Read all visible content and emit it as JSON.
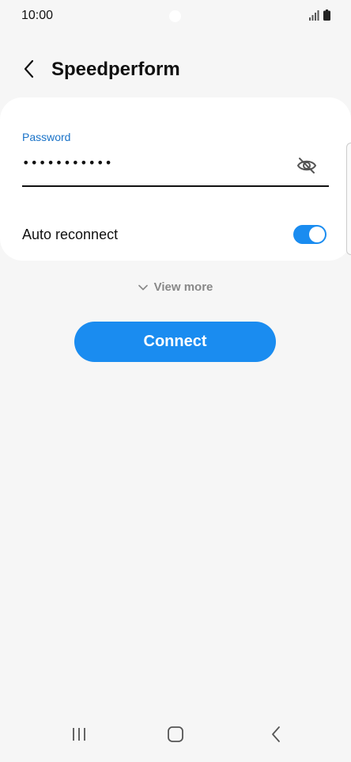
{
  "status_bar": {
    "time": "10:00",
    "icons": [
      "signal-icon",
      "battery-icon"
    ]
  },
  "header": {
    "title": "Speedperform",
    "back_icon": "chevron-left-icon"
  },
  "form": {
    "password_label": "Password",
    "password_value": "•••••••••••",
    "visibility_icon": "eye-off-icon",
    "auto_reconnect_label": "Auto reconnect",
    "auto_reconnect_enabled": true
  },
  "view_more": {
    "label": "View more",
    "icon": "chevron-down-icon"
  },
  "connect": {
    "label": "Connect"
  },
  "nav_bar": {
    "icons": [
      "recents-icon",
      "home-icon",
      "back-icon"
    ]
  },
  "colors": {
    "accent": "#1a8cf0",
    "label_blue": "#1a73c8",
    "background": "#f6f6f6",
    "card": "#ffffff"
  }
}
